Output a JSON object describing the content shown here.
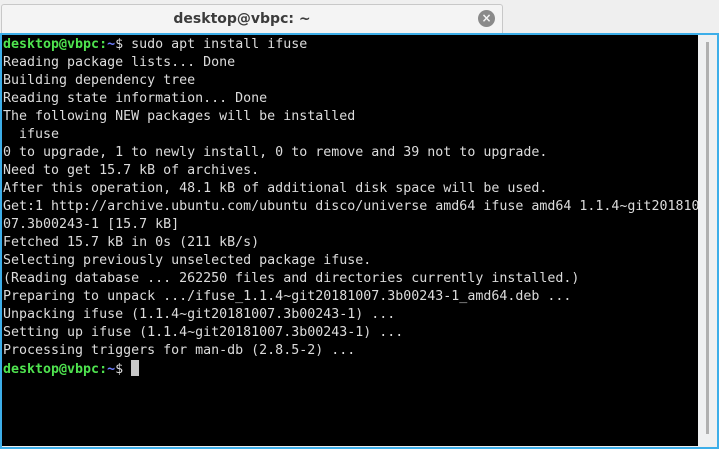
{
  "window": {
    "tab_title": "desktop@vbpc: ~"
  },
  "prompt": {
    "user_host": "desktop@vbpc",
    "colon": ":",
    "path": "~",
    "symbol": "$"
  },
  "command": " sudo apt install ifuse",
  "output": [
    "Reading package lists... Done",
    "Building dependency tree",
    "Reading state information... Done",
    "The following NEW packages will be installed",
    "  ifuse",
    "0 to upgrade, 1 to newly install, 0 to remove and 39 not to upgrade.",
    "Need to get 15.7 kB of archives.",
    "After this operation, 48.1 kB of additional disk space will be used.",
    "Get:1 http://archive.ubuntu.com/ubuntu disco/universe amd64 ifuse amd64 1.1.4~git201810",
    "07.3b00243-1 [15.7 kB]",
    "Fetched 15.7 kB in 0s (211 kB/s)",
    "Selecting previously unselected package ifuse.",
    "(Reading database ... 262250 files and directories currently installed.)",
    "Preparing to unpack .../ifuse_1.1.4~git20181007.3b00243-1_amd64.deb ...",
    "Unpacking ifuse (1.1.4~git20181007.3b00243-1) ...",
    "Setting up ifuse (1.1.4~git20181007.3b00243-1) ...",
    "Processing triggers for man-db (2.8.5-2) ..."
  ]
}
